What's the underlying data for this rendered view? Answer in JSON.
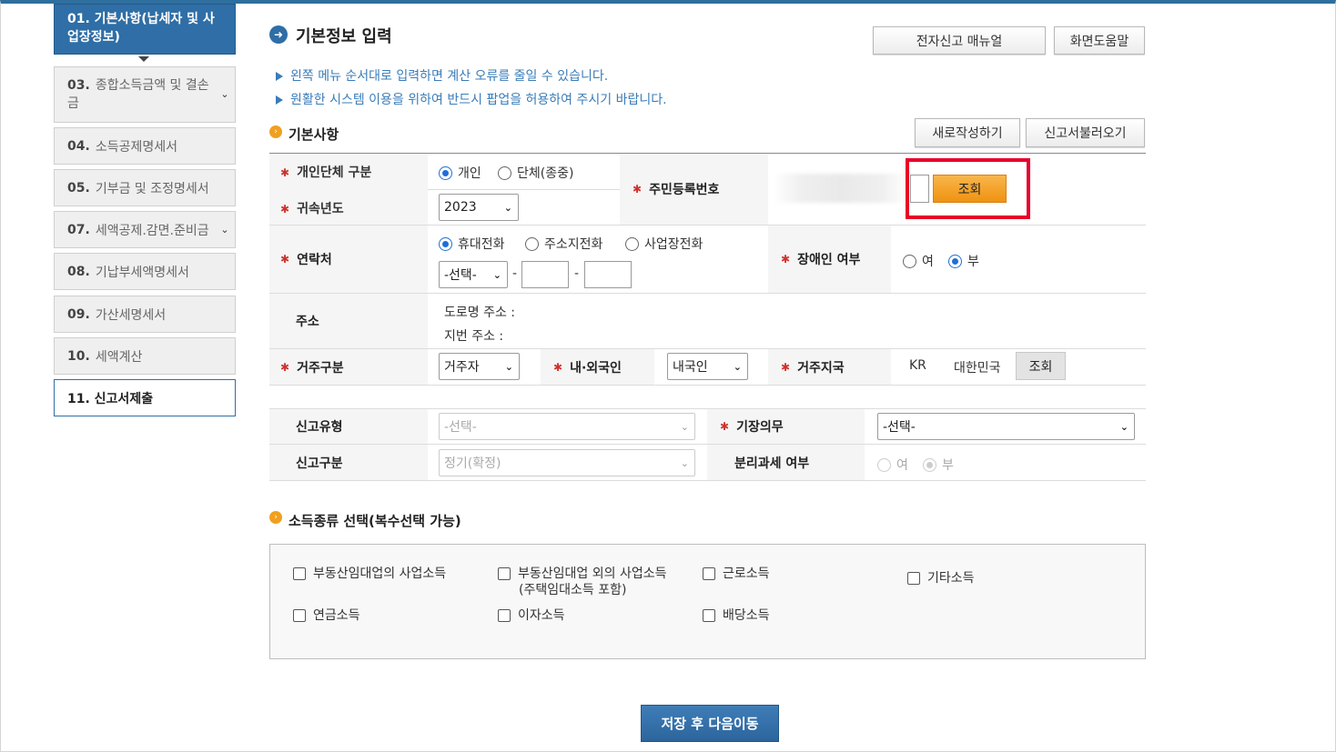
{
  "sidebar": {
    "active": "01. 기본사항(납세자 및 사업장정보)",
    "items": [
      {
        "num": "03.",
        "label": "종합소득금액 및 결손금"
      },
      {
        "num": "04.",
        "label": "소득공제명세서"
      },
      {
        "num": "05.",
        "label": "기부금 및 조정명세서"
      },
      {
        "num": "07.",
        "label": "세액공제.감면.준비금"
      },
      {
        "num": "08.",
        "label": "기납부세액명세서"
      },
      {
        "num": "09.",
        "label": "가산세명세서"
      },
      {
        "num": "10.",
        "label": "세액계산"
      }
    ],
    "final": "11. 신고서제출"
  },
  "header": {
    "title": "기본정보 입력",
    "manual_btn": "전자신고 매뉴얼",
    "help_btn": "화면도움말",
    "notices": [
      "왼쪽 메뉴 순서대로 입력하면 계산 오류를 줄일 수 있습니다.",
      "원활한 시스템 이용을 위하여 반드시 팝업을 허용하여 주시기 바랍니다."
    ]
  },
  "basic": {
    "section_title": "기본사항",
    "new_btn": "새로작성하기",
    "load_btn": "신고서불러오기",
    "type_label": "개인단체 구분",
    "type_opts": [
      "개인",
      "단체(종중)"
    ],
    "year_label": "귀속년도",
    "year_value": "2023",
    "rrn_label": "주민등록번호",
    "lookup_btn": "조회",
    "contact_label": "연락처",
    "phone_opts": [
      "휴대전화",
      "주소지전화",
      "사업장전화"
    ],
    "phone_select": "-선택-",
    "dash": "-",
    "disabled_label": "장애인 여부",
    "yes": "여",
    "no": "부",
    "address_label": "주소",
    "road_addr": "도로명 주소 :",
    "lot_addr": "지번 주소 :",
    "residence_label": "거주구분",
    "residence_value": "거주자",
    "nationality_label": "내·외국인",
    "nationality_value": "내국인",
    "country_label": "거주지국",
    "country_code": "KR",
    "country_name": "대한민국",
    "country_btn": "조회"
  },
  "filing": {
    "type_label": "신고유형",
    "type_value": "-선택-",
    "book_label": "기장의무",
    "book_value": "-선택-",
    "kind_label": "신고구분",
    "kind_value": "정기(확정)",
    "separate_label": "분리과세 여부",
    "yes": "여",
    "no": "부"
  },
  "income": {
    "section_title": "소득종류 선택(복수선택 가능)",
    "items": [
      "부동산임대업의 사업소득",
      "부동산임대업 외의 사업소득",
      "(주택임대소득 포함)",
      "근로소득",
      "기타소득",
      "연금소득",
      "이자소득",
      "배당소득"
    ]
  },
  "save_btn": "저장 후 다음이동"
}
